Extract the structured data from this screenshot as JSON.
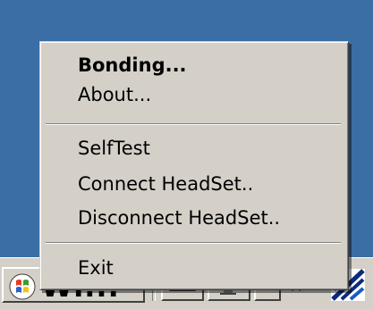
{
  "menu": {
    "items": [
      {
        "label": "Bonding...",
        "bold": true
      },
      {
        "label": "About..."
      },
      {
        "separator": true
      },
      {
        "label": "SelfTest"
      },
      {
        "label": "Connect HeadSet.."
      },
      {
        "label": "Disconnect HeadSet.."
      },
      {
        "separator": true
      },
      {
        "label": "Exit"
      }
    ]
  },
  "taskbar": {
    "start_label": "Wi...",
    "icons": [
      "windows-logo-icon",
      "keyboard-icon",
      "monitor-icon",
      "chevron-down-icon",
      "double-chevron-icon",
      "signal-icon"
    ]
  },
  "colors": {
    "desktop": "#3a6ea5",
    "menu_bg": "#d4d0c8",
    "text": "#000000"
  }
}
